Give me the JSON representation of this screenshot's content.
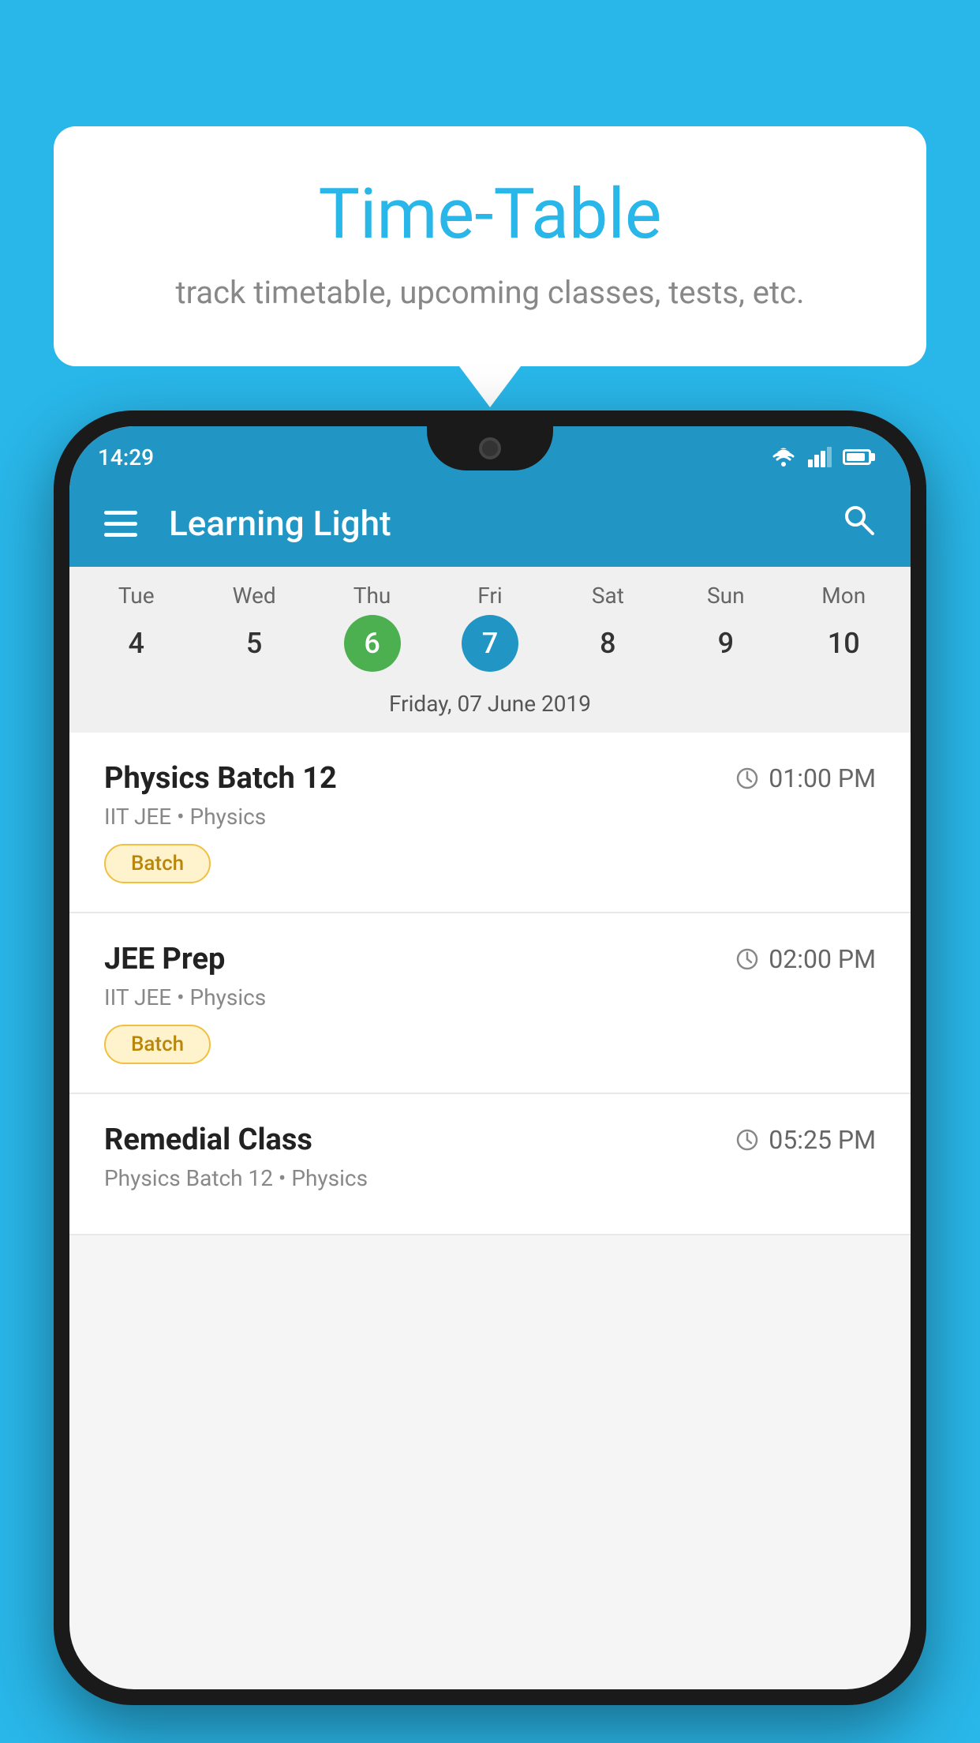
{
  "background": {
    "color": "#29b6e8"
  },
  "speech_bubble": {
    "title": "Time-Table",
    "subtitle": "track timetable, upcoming classes, tests, etc."
  },
  "phone": {
    "status_bar": {
      "time": "14:29"
    },
    "app_bar": {
      "title": "Learning Light"
    },
    "calendar": {
      "days": [
        {
          "name": "Tue",
          "number": "4",
          "state": "normal"
        },
        {
          "name": "Wed",
          "number": "5",
          "state": "normal"
        },
        {
          "name": "Thu",
          "number": "6",
          "state": "today"
        },
        {
          "name": "Fri",
          "number": "7",
          "state": "selected"
        },
        {
          "name": "Sat",
          "number": "8",
          "state": "normal"
        },
        {
          "name": "Sun",
          "number": "9",
          "state": "normal"
        },
        {
          "name": "Mon",
          "number": "10",
          "state": "normal"
        }
      ],
      "selected_date_label": "Friday, 07 June 2019"
    },
    "schedule": {
      "items": [
        {
          "name": "Physics Batch 12",
          "time": "01:00 PM",
          "meta": "IIT JEE • Physics",
          "badge": "Batch"
        },
        {
          "name": "JEE Prep",
          "time": "02:00 PM",
          "meta": "IIT JEE • Physics",
          "badge": "Batch"
        },
        {
          "name": "Remedial Class",
          "time": "05:25 PM",
          "meta": "Physics Batch 12 • Physics",
          "badge": null
        }
      ]
    }
  },
  "icons": {
    "hamburger": "☰",
    "search": "🔍",
    "clock": "🕐"
  }
}
